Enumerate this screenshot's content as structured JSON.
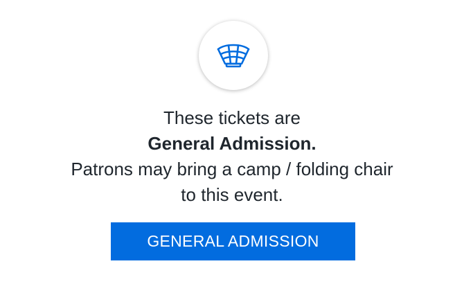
{
  "icon": {
    "name": "stadium-seating-icon",
    "color": "#026cdf"
  },
  "message": {
    "line1": "These tickets are",
    "line2": "General Admission.",
    "line3": "Patrons may bring a camp / folding chair",
    "line4": "to this event."
  },
  "button": {
    "label": "GENERAL ADMISSION",
    "color": "#026cdf"
  }
}
